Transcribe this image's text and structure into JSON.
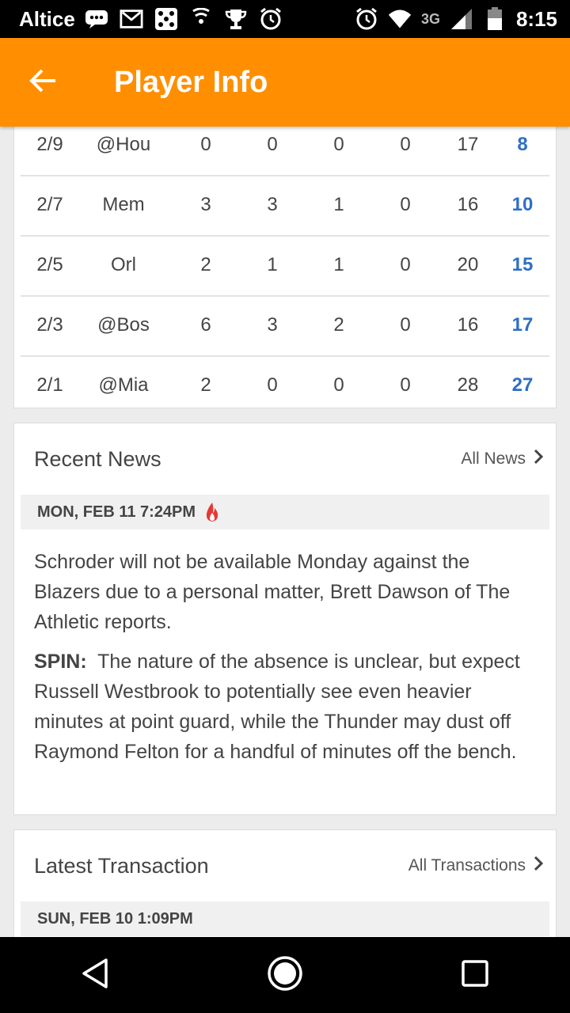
{
  "status_bar": {
    "carrier": "Altice",
    "network": "3G",
    "time": "8:15"
  },
  "app_bar": {
    "title": "Player Info"
  },
  "game_log": [
    {
      "date": "2/9",
      "opp": "@Hou",
      "s1": "0",
      "s2": "0",
      "s3": "0",
      "s4": "0",
      "min": "17",
      "pts": "8"
    },
    {
      "date": "2/7",
      "opp": "Mem",
      "s1": "3",
      "s2": "3",
      "s3": "1",
      "s4": "0",
      "min": "16",
      "pts": "10"
    },
    {
      "date": "2/5",
      "opp": "Orl",
      "s1": "2",
      "s2": "1",
      "s3": "1",
      "s4": "0",
      "min": "20",
      "pts": "15"
    },
    {
      "date": "2/3",
      "opp": "@Bos",
      "s1": "6",
      "s2": "3",
      "s3": "2",
      "s4": "0",
      "min": "16",
      "pts": "17"
    },
    {
      "date": "2/1",
      "opp": "@Mia",
      "s1": "2",
      "s2": "0",
      "s3": "0",
      "s4": "0",
      "min": "28",
      "pts": "27"
    }
  ],
  "news": {
    "heading": "Recent News",
    "link": "All News",
    "date": "MON, FEB 11 7:24PM",
    "body": "Schroder will not be available Monday against the Blazers due to a personal matter, Brett Dawson of The Athletic reports.",
    "spin_label": "SPIN:",
    "spin": "The nature of the absence is unclear, but expect Russell Westbrook to potentially see even heavier minutes at point guard, while the Thunder may dust off Raymond Felton for a handful of minutes off the bench."
  },
  "transaction": {
    "heading": "Latest Transaction",
    "link": "All Transactions",
    "date": "SUN, FEB 10 1:09PM"
  },
  "colors": {
    "accent": "#ff8f00",
    "points": "#2f6fc4",
    "hot": "#e53935"
  },
  "icons": {
    "back": "arrow-back-icon",
    "chevron": "chevron-right-icon",
    "hot": "fire-icon",
    "nav_back": "triangle-back-icon",
    "nav_home": "circle-home-icon",
    "nav_recents": "square-recents-icon"
  }
}
